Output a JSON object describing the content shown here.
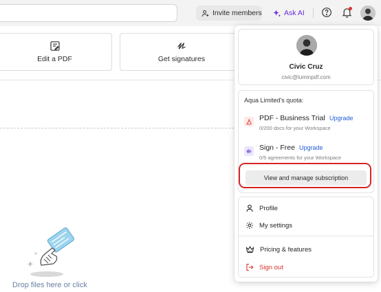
{
  "topbar": {
    "invite_label": "Invite members",
    "ask_ai_label": "Ask AI",
    "accent_color": "#6a2bd9"
  },
  "main": {
    "actions": [
      {
        "label": "Edit a PDF",
        "icon": "edit-pdf-icon"
      },
      {
        "label": "Get signatures",
        "icon": "signature-icon"
      }
    ],
    "drop_text": "Drop files here or click"
  },
  "dropdown": {
    "user": {
      "name": "Civic Cruz",
      "email": "civic@luminpdf.com"
    },
    "quota": {
      "title": "Aqua Limited's quota:",
      "plans": [
        {
          "name": "PDF - Business Trial",
          "upgrade": "Upgrade",
          "detail": "0/200 docs for your Workspace",
          "icon": "pdf-icon"
        },
        {
          "name": "Sign - Free",
          "upgrade": "Upgrade",
          "detail": "0/5 agreements for your Workspace",
          "icon": "sign-icon"
        }
      ],
      "view_button": "View and manage subscription"
    },
    "menu": [
      {
        "label": "Profile",
        "icon": "user-icon"
      },
      {
        "label": "My settings",
        "icon": "gear-icon"
      },
      {
        "label": "Pricing & features",
        "icon": "crown-icon"
      },
      {
        "label": "Sign out",
        "icon": "sign-out-icon"
      }
    ],
    "highlight_color": "#d92424",
    "signout_color": "#d73228"
  }
}
